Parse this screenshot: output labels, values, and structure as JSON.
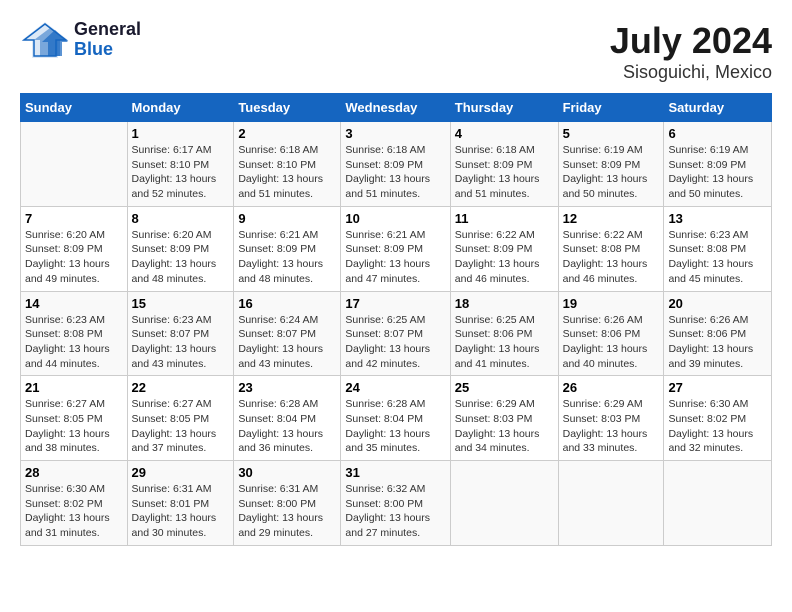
{
  "logo": {
    "general": "General",
    "blue": "Blue"
  },
  "title": "July 2024",
  "subtitle": "Sisoguichi, Mexico",
  "days_header": [
    "Sunday",
    "Monday",
    "Tuesday",
    "Wednesday",
    "Thursday",
    "Friday",
    "Saturday"
  ],
  "weeks": [
    [
      {
        "num": "",
        "sunrise": "",
        "sunset": "",
        "daylight": ""
      },
      {
        "num": "1",
        "sunrise": "Sunrise: 6:17 AM",
        "sunset": "Sunset: 8:10 PM",
        "daylight": "Daylight: 13 hours and 52 minutes."
      },
      {
        "num": "2",
        "sunrise": "Sunrise: 6:18 AM",
        "sunset": "Sunset: 8:10 PM",
        "daylight": "Daylight: 13 hours and 51 minutes."
      },
      {
        "num": "3",
        "sunrise": "Sunrise: 6:18 AM",
        "sunset": "Sunset: 8:09 PM",
        "daylight": "Daylight: 13 hours and 51 minutes."
      },
      {
        "num": "4",
        "sunrise": "Sunrise: 6:18 AM",
        "sunset": "Sunset: 8:09 PM",
        "daylight": "Daylight: 13 hours and 51 minutes."
      },
      {
        "num": "5",
        "sunrise": "Sunrise: 6:19 AM",
        "sunset": "Sunset: 8:09 PM",
        "daylight": "Daylight: 13 hours and 50 minutes."
      },
      {
        "num": "6",
        "sunrise": "Sunrise: 6:19 AM",
        "sunset": "Sunset: 8:09 PM",
        "daylight": "Daylight: 13 hours and 50 minutes."
      }
    ],
    [
      {
        "num": "7",
        "sunrise": "Sunrise: 6:20 AM",
        "sunset": "Sunset: 8:09 PM",
        "daylight": "Daylight: 13 hours and 49 minutes."
      },
      {
        "num": "8",
        "sunrise": "Sunrise: 6:20 AM",
        "sunset": "Sunset: 8:09 PM",
        "daylight": "Daylight: 13 hours and 48 minutes."
      },
      {
        "num": "9",
        "sunrise": "Sunrise: 6:21 AM",
        "sunset": "Sunset: 8:09 PM",
        "daylight": "Daylight: 13 hours and 48 minutes."
      },
      {
        "num": "10",
        "sunrise": "Sunrise: 6:21 AM",
        "sunset": "Sunset: 8:09 PM",
        "daylight": "Daylight: 13 hours and 47 minutes."
      },
      {
        "num": "11",
        "sunrise": "Sunrise: 6:22 AM",
        "sunset": "Sunset: 8:09 PM",
        "daylight": "Daylight: 13 hours and 46 minutes."
      },
      {
        "num": "12",
        "sunrise": "Sunrise: 6:22 AM",
        "sunset": "Sunset: 8:08 PM",
        "daylight": "Daylight: 13 hours and 46 minutes."
      },
      {
        "num": "13",
        "sunrise": "Sunrise: 6:23 AM",
        "sunset": "Sunset: 8:08 PM",
        "daylight": "Daylight: 13 hours and 45 minutes."
      }
    ],
    [
      {
        "num": "14",
        "sunrise": "Sunrise: 6:23 AM",
        "sunset": "Sunset: 8:08 PM",
        "daylight": "Daylight: 13 hours and 44 minutes."
      },
      {
        "num": "15",
        "sunrise": "Sunrise: 6:23 AM",
        "sunset": "Sunset: 8:07 PM",
        "daylight": "Daylight: 13 hours and 43 minutes."
      },
      {
        "num": "16",
        "sunrise": "Sunrise: 6:24 AM",
        "sunset": "Sunset: 8:07 PM",
        "daylight": "Daylight: 13 hours and 43 minutes."
      },
      {
        "num": "17",
        "sunrise": "Sunrise: 6:25 AM",
        "sunset": "Sunset: 8:07 PM",
        "daylight": "Daylight: 13 hours and 42 minutes."
      },
      {
        "num": "18",
        "sunrise": "Sunrise: 6:25 AM",
        "sunset": "Sunset: 8:06 PM",
        "daylight": "Daylight: 13 hours and 41 minutes."
      },
      {
        "num": "19",
        "sunrise": "Sunrise: 6:26 AM",
        "sunset": "Sunset: 8:06 PM",
        "daylight": "Daylight: 13 hours and 40 minutes."
      },
      {
        "num": "20",
        "sunrise": "Sunrise: 6:26 AM",
        "sunset": "Sunset: 8:06 PM",
        "daylight": "Daylight: 13 hours and 39 minutes."
      }
    ],
    [
      {
        "num": "21",
        "sunrise": "Sunrise: 6:27 AM",
        "sunset": "Sunset: 8:05 PM",
        "daylight": "Daylight: 13 hours and 38 minutes."
      },
      {
        "num": "22",
        "sunrise": "Sunrise: 6:27 AM",
        "sunset": "Sunset: 8:05 PM",
        "daylight": "Daylight: 13 hours and 37 minutes."
      },
      {
        "num": "23",
        "sunrise": "Sunrise: 6:28 AM",
        "sunset": "Sunset: 8:04 PM",
        "daylight": "Daylight: 13 hours and 36 minutes."
      },
      {
        "num": "24",
        "sunrise": "Sunrise: 6:28 AM",
        "sunset": "Sunset: 8:04 PM",
        "daylight": "Daylight: 13 hours and 35 minutes."
      },
      {
        "num": "25",
        "sunrise": "Sunrise: 6:29 AM",
        "sunset": "Sunset: 8:03 PM",
        "daylight": "Daylight: 13 hours and 34 minutes."
      },
      {
        "num": "26",
        "sunrise": "Sunrise: 6:29 AM",
        "sunset": "Sunset: 8:03 PM",
        "daylight": "Daylight: 13 hours and 33 minutes."
      },
      {
        "num": "27",
        "sunrise": "Sunrise: 6:30 AM",
        "sunset": "Sunset: 8:02 PM",
        "daylight": "Daylight: 13 hours and 32 minutes."
      }
    ],
    [
      {
        "num": "28",
        "sunrise": "Sunrise: 6:30 AM",
        "sunset": "Sunset: 8:02 PM",
        "daylight": "Daylight: 13 hours and 31 minutes."
      },
      {
        "num": "29",
        "sunrise": "Sunrise: 6:31 AM",
        "sunset": "Sunset: 8:01 PM",
        "daylight": "Daylight: 13 hours and 30 minutes."
      },
      {
        "num": "30",
        "sunrise": "Sunrise: 6:31 AM",
        "sunset": "Sunset: 8:00 PM",
        "daylight": "Daylight: 13 hours and 29 minutes."
      },
      {
        "num": "31",
        "sunrise": "Sunrise: 6:32 AM",
        "sunset": "Sunset: 8:00 PM",
        "daylight": "Daylight: 13 hours and 27 minutes."
      },
      {
        "num": "",
        "sunrise": "",
        "sunset": "",
        "daylight": ""
      },
      {
        "num": "",
        "sunrise": "",
        "sunset": "",
        "daylight": ""
      },
      {
        "num": "",
        "sunrise": "",
        "sunset": "",
        "daylight": ""
      }
    ]
  ]
}
